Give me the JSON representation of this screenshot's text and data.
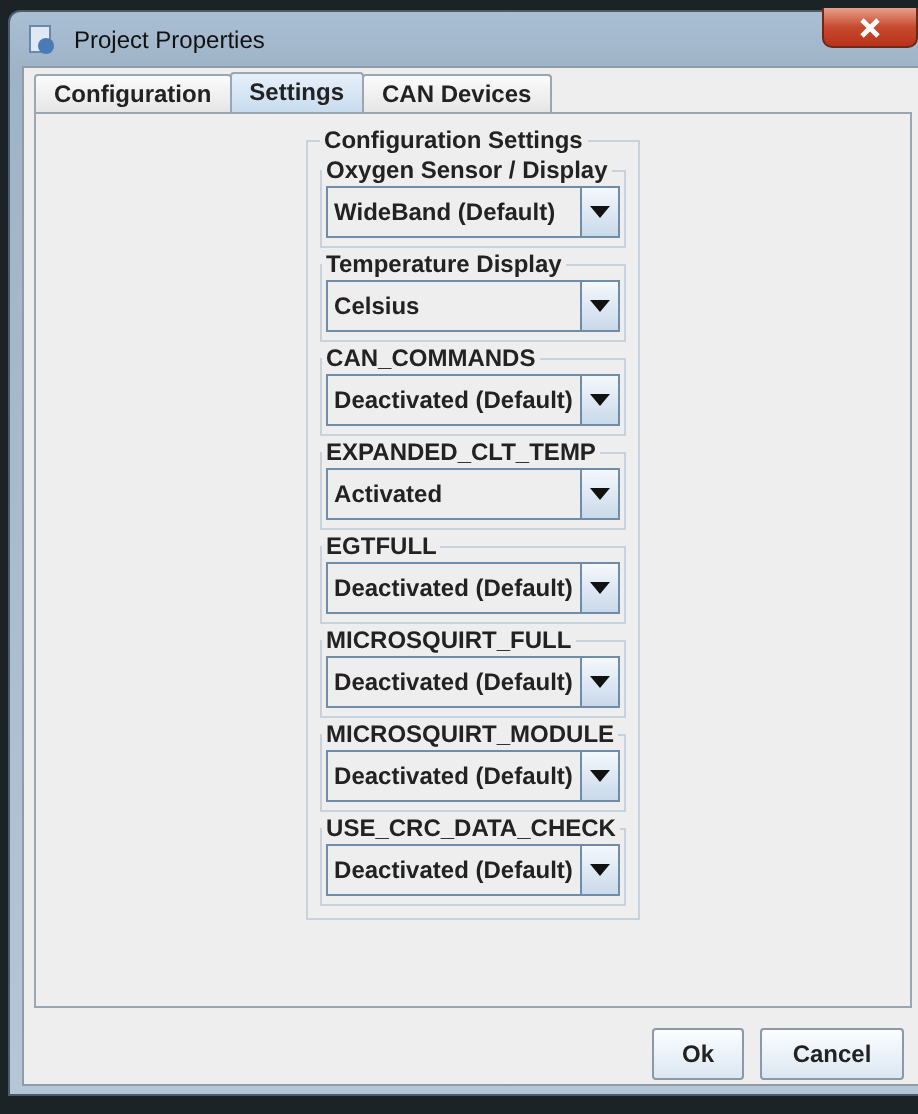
{
  "window": {
    "title": "Project Properties"
  },
  "tabs": [
    {
      "label": "Configuration",
      "selected": false
    },
    {
      "label": "Settings",
      "selected": true
    },
    {
      "label": "CAN Devices",
      "selected": false
    }
  ],
  "group": {
    "title": "Configuration Settings",
    "settings": [
      {
        "label": "Oxygen Sensor / Display",
        "value": "WideBand (Default)"
      },
      {
        "label": "Temperature Display",
        "value": "Celsius"
      },
      {
        "label": "CAN_COMMANDS",
        "value": "Deactivated (Default)"
      },
      {
        "label": "EXPANDED_CLT_TEMP",
        "value": "Activated"
      },
      {
        "label": "EGTFULL",
        "value": "Deactivated (Default)"
      },
      {
        "label": "MICROSQUIRT_FULL",
        "value": "Deactivated (Default)"
      },
      {
        "label": "MICROSQUIRT_MODULE",
        "value": "Deactivated (Default)"
      },
      {
        "label": "USE_CRC_DATA_CHECK",
        "value": "Deactivated (Default)"
      }
    ]
  },
  "buttons": [
    "Ok",
    "Cancel"
  ]
}
